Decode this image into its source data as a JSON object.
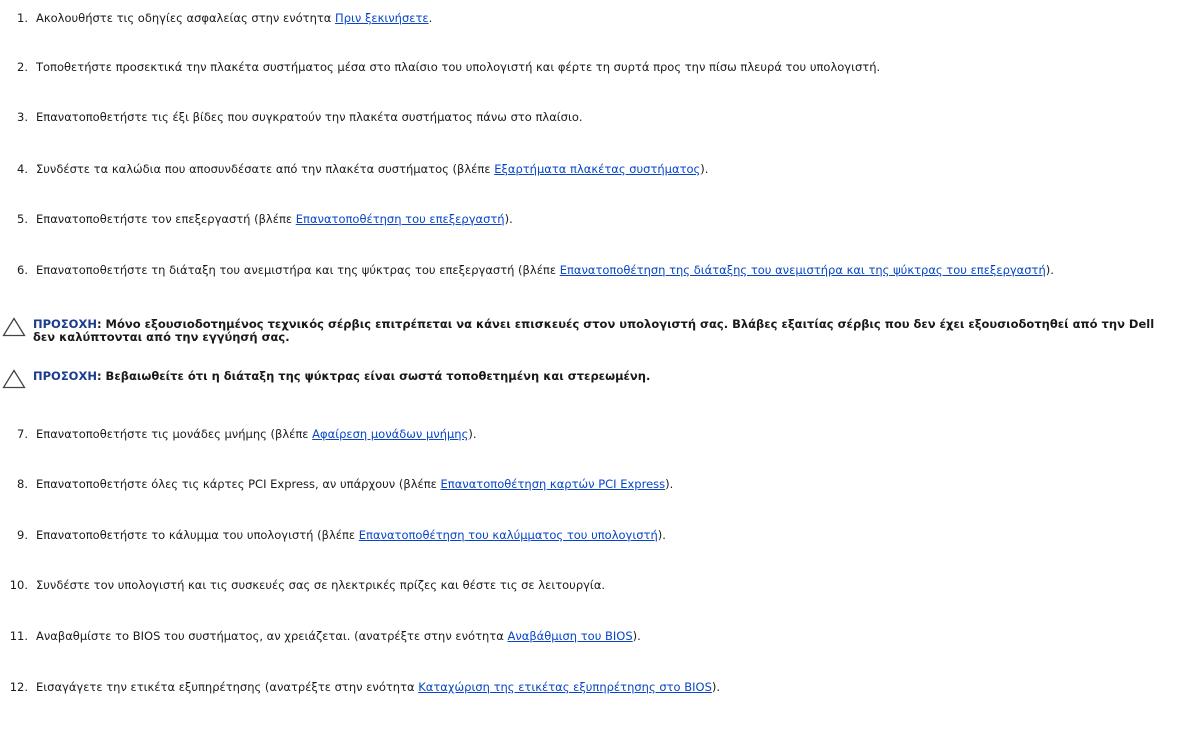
{
  "steps_a": [
    {
      "num": "1.",
      "before": "Ακολουθήστε τις οδηγίες ασφαλείας στην ενότητα ",
      "link": "Πριν ξεκινήσετε",
      "after": "."
    },
    {
      "num": "2.",
      "before": "Τοποθετήστε προσεκτικά την πλακέτα συστήματος μέσα στο πλαίσιο του υπολογιστή και φέρτε τη συρτά προς την πίσω πλευρά του υπολογιστή.",
      "link": "",
      "after": ""
    },
    {
      "num": "3.",
      "before": "Επανατοποθετήστε τις έξι βίδες που συγκρατούν την πλακέτα συστήματος πάνω στο πλαίσιο.",
      "link": "",
      "after": ""
    },
    {
      "num": "4.",
      "before": "Συνδέστε τα καλώδια που αποσυνδέσατε από την πλακέτα συστήματος (βλέπε ",
      "link": "Εξαρτήματα πλακέτας συστήματος",
      "after": ")."
    },
    {
      "num": "5.",
      "before": "Επανατοποθετήστε τον επεξεργαστή (βλέπε ",
      "link": "Επανατοποθέτηση του επεξεργαστή",
      "after": ")."
    },
    {
      "num": "6.",
      "before": "Επανατοποθετήστε τη διάταξη του ανεμιστήρα και της ψύκτρας του επεξεργαστή (βλέπε ",
      "link": "Επανατοποθέτηση της διάταξης του ανεμιστήρα και της ψύκτρας του επεξεργαστή",
      "after": ")."
    }
  ],
  "cautions": [
    {
      "label": "ΠΡΟΣΟΧΗ",
      "text": ": Μόνο εξουσιοδοτημένος τεχνικός σέρβις επιτρέπεται να κάνει επισκευές στον υπολογιστή σας. Βλάβες εξαιτίας σέρβις που δεν έχει εξουσιοδοτηθεί από την Dell δεν καλύπτονται από την εγγύησή σας."
    },
    {
      "label": "ΠΡΟΣΟΧΗ",
      "text": ": Βεβαιωθείτε ότι η διάταξη της ψύκτρας είναι σωστά τοποθετημένη και στερεωμένη."
    }
  ],
  "steps_b": [
    {
      "num": "7.",
      "before": "Επανατοποθετήστε τις μονάδες μνήμης (βλέπε ",
      "link": "Αφαίρεση μονάδων μνήμης",
      "after": ")."
    },
    {
      "num": "8.",
      "before": "Επανατοποθετήστε όλες τις κάρτες PCI Express, αν υπάρχουν (βλέπε ",
      "link": "Επανατοποθέτηση καρτών PCI Express",
      "after": ")."
    },
    {
      "num": "9.",
      "before": "Επανατοποθετήστε το κάλυμμα του υπολογιστή (βλέπε ",
      "link": "Επανατοποθέτηση του καλύμματος του υπολογιστή",
      "after": ")."
    },
    {
      "num": "10.",
      "before": "Συνδέστε τον υπολογιστή και τις συσκευές σας σε ηλεκτρικές πρίζες και θέστε τις σε λειτουργία.",
      "link": "",
      "after": ""
    },
    {
      "num": "11.",
      "before": "Αναβαθμίστε το BIOS του συστήματος, αν χρειάζεται. (ανατρέξτε στην ενότητα ",
      "link": "Αναβάθμιση του BIOS",
      "after": ")."
    },
    {
      "num": "12.",
      "before": "Εισαγάγετε την ετικέτα εξυπηρέτησης (ανατρέξτε στην ενότητα ",
      "link": "Καταχώριση της ετικέτας εξυπηρέτησης στο BIOS",
      "after": ")."
    }
  ],
  "icons": {
    "caution": "warning-triangle-icon"
  }
}
